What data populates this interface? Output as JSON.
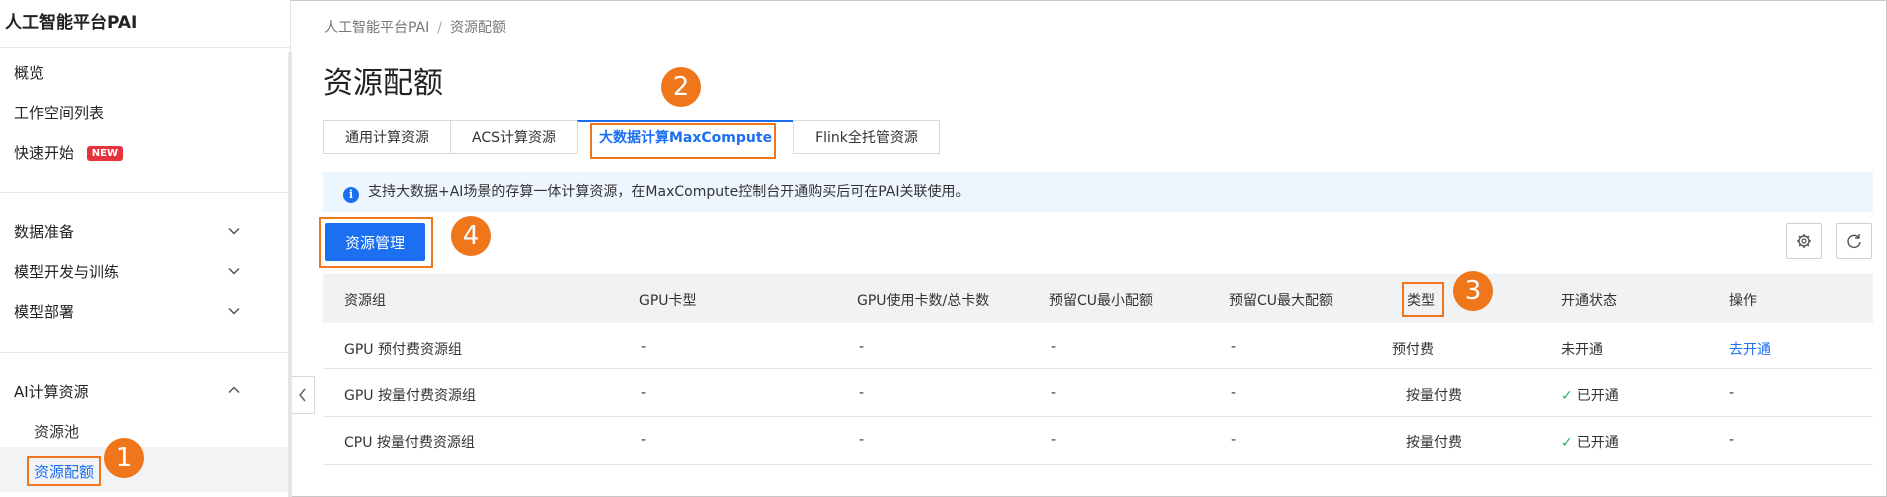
{
  "sidebar": {
    "brand": "人工智能平台PAI",
    "top_items": [
      {
        "label": "概览"
      },
      {
        "label": "工作空间列表"
      },
      {
        "label": "快速开始",
        "badge": "NEW"
      }
    ],
    "groups": [
      {
        "label": "数据准备"
      },
      {
        "label": "模型开发与训练"
      },
      {
        "label": "模型部署"
      }
    ],
    "ai_group": {
      "label": "AI计算资源",
      "children": [
        {
          "label": "资源池"
        },
        {
          "label": "资源配额",
          "active": true
        }
      ]
    }
  },
  "breadcrumb": {
    "root": "人工智能平台PAI",
    "separator": "/",
    "current": "资源配额"
  },
  "page_title": "资源配额",
  "tabs": [
    {
      "label": "通用计算资源"
    },
    {
      "label": "ACS计算资源"
    },
    {
      "label": "大数据计算MaxCompute",
      "active": true
    },
    {
      "label": "Flink全托管资源"
    }
  ],
  "info_banner": "支持大数据+AI场景的存算一体计算资源，在MaxCompute控制台开通购买后可在PAI关联使用。",
  "toolbar": {
    "manage_button": "资源管理",
    "settings_icon": "gear-icon",
    "refresh_icon": "refresh-icon"
  },
  "table": {
    "columns": [
      "资源组",
      "GPU卡型",
      "GPU使用卡数/总卡数",
      "预留CU最小配额",
      "预留CU最大配额",
      "类型",
      "开通状态",
      "操作"
    ],
    "rows": [
      {
        "group": "GPU 预付费资源组",
        "gpu_type": "-",
        "gpu_usage": "-",
        "cu_min": "-",
        "cu_max": "-",
        "type": "预付费",
        "status": "未开通",
        "status_ok": false,
        "action": "去开通"
      },
      {
        "group": "GPU 按量付费资源组",
        "gpu_type": "-",
        "gpu_usage": "-",
        "cu_min": "-",
        "cu_max": "-",
        "type": "按量付费",
        "status": "已开通",
        "status_ok": true,
        "action": "-"
      },
      {
        "group": "CPU 按量付费资源组",
        "gpu_type": "-",
        "gpu_usage": "-",
        "cu_min": "-",
        "cu_max": "-",
        "type": "按量付费",
        "status": "已开通",
        "status_ok": true,
        "action": "-"
      }
    ]
  },
  "markers": [
    "1",
    "2",
    "3",
    "4"
  ],
  "colors": {
    "accent": "#1b6ff1",
    "highlight": "#f0761b",
    "new_badge": "#e5343d",
    "success": "#27ae60",
    "info_bg": "#edf5ff"
  }
}
